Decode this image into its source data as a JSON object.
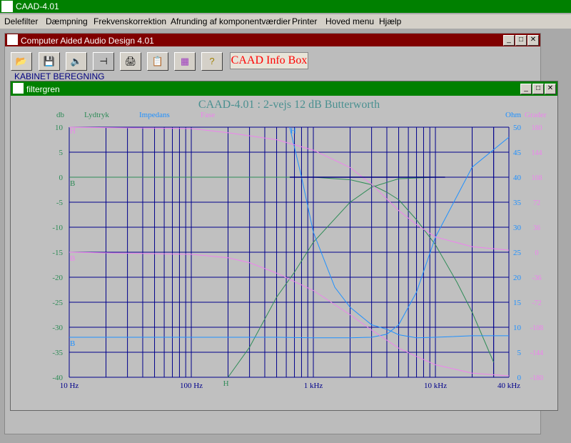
{
  "app": {
    "title": "CAAD-4.01"
  },
  "menu": [
    "Delefilter",
    "Dæmpning",
    "Frekvenskorrektion",
    "Afrunding af komponentværdier",
    "Printer",
    "Hoved menu",
    "Hjælp"
  ],
  "main_window": {
    "title": "Computer Aided Audio Design 4.01",
    "info_box": "CAAD Info Box",
    "kabinet_label": "KABINET BEREGNING",
    "toolbar": [
      "open-icon",
      "save-icon",
      "speaker-icon",
      "filter-icon",
      "printer-icon",
      "clipboard-icon",
      "grid-icon",
      "help-icon"
    ]
  },
  "filter_window": {
    "title": "filtergren"
  },
  "chart_data": {
    "type": "line",
    "title": "CAAD-4.01 : 2-vejs 12 dB Butterworth",
    "x_scale": "log",
    "xlim": [
      10,
      40000
    ],
    "x_tick_labels": [
      {
        "value": 10,
        "label": "10 Hz"
      },
      {
        "value": 100,
        "label": "100 Hz"
      },
      {
        "value": 1000,
        "label": "1 kHz"
      },
      {
        "value": 10000,
        "label": "10 kHz"
      },
      {
        "value": 40000,
        "label": "40 kHz"
      }
    ],
    "left_axis": {
      "unit_label": "db",
      "ylim": [
        -40,
        10
      ],
      "ticks": [
        10,
        5,
        0,
        -5,
        -10,
        -15,
        -20,
        -25,
        -30,
        -35,
        -40
      ]
    },
    "right_axis_ohm": {
      "unit_label": "Ohm",
      "ylim": [
        0,
        50
      ],
      "ticks": [
        50,
        45,
        40,
        35,
        30,
        25,
        20,
        15,
        10,
        5,
        0
      ]
    },
    "right_axis_grader": {
      "unit_label": "Grader",
      "ylim": [
        -180,
        180
      ],
      "ticks": [
        180,
        144,
        108,
        72,
        36,
        0,
        -36,
        -72,
        -108,
        -144,
        -180
      ]
    },
    "legend": [
      {
        "label": "Lydtryk",
        "color": "#2e8b57"
      },
      {
        "label": "Impedans",
        "color": "#1e90ff"
      },
      {
        "label": "Fase",
        "color": "#ee82ee"
      }
    ],
    "curve_markers": [
      {
        "text": "H",
        "color": "#ee82ee",
        "x": 10,
        "y_db": 9.5
      },
      {
        "text": "B",
        "color": "#2e8b57",
        "x": 10,
        "y_db": -1
      },
      {
        "text": "B",
        "color": "#ee82ee",
        "x": 10,
        "y_db": -16
      },
      {
        "text": "B",
        "color": "#1e90ff",
        "x": 10,
        "y_db": -33
      },
      {
        "text": "H",
        "color": "#1e90ff",
        "x": 640,
        "y_db": 9.5
      },
      {
        "text": "H",
        "color": "#2e8b57",
        "x": 180,
        "y_db": -41
      }
    ],
    "series": [
      {
        "name": "Lydtryk",
        "axis": "db",
        "color": "#2e8b57",
        "x": [
          10,
          100,
          1000,
          2000,
          3000,
          4000,
          5000,
          7000,
          10000,
          15000,
          20000,
          30000
        ],
        "y": [
          0,
          0,
          0,
          -0.5,
          -1.5,
          -3,
          -4.5,
          -8.5,
          -13.5,
          -21,
          -27,
          -37
        ]
      },
      {
        "name": "Lydtryk",
        "axis": "db",
        "color": "#2e8b57",
        "x": [
          200,
          300,
          500,
          700,
          1000,
          2000,
          3000,
          5000,
          10000
        ],
        "y": [
          -40,
          -34,
          -24,
          -19,
          -13,
          -5,
          -2,
          -0.3,
          0
        ]
      },
      {
        "name": "Impedans",
        "axis": "ohm",
        "color": "#1e90ff",
        "x": [
          10,
          100,
          500,
          1000,
          2000,
          3000,
          4000,
          5000,
          7000,
          10000,
          20000,
          40000
        ],
        "y": [
          8,
          8,
          8,
          7.9,
          7.9,
          8,
          8.6,
          10.5,
          17,
          28,
          42,
          48
        ]
      },
      {
        "name": "Impedans",
        "axis": "ohm",
        "color": "#1e90ff",
        "x": [
          640,
          800,
          1000,
          1500,
          2000,
          3000,
          4000,
          5000,
          7000,
          10000,
          20000,
          40000
        ],
        "y": [
          50,
          40,
          29,
          18,
          14,
          10.5,
          9.6,
          8.5,
          7.9,
          8,
          8.3,
          8.3
        ]
      },
      {
        "name": "Fase",
        "axis": "grader",
        "color": "#ee82ee",
        "x": [
          10,
          100,
          200,
          500,
          1000,
          2000,
          3000,
          5000,
          7000,
          10000,
          20000,
          40000
        ],
        "y": [
          180,
          178,
          172,
          162,
          147,
          122,
          98,
          60,
          40,
          22,
          8,
          3
        ]
      },
      {
        "name": "Fase",
        "axis": "grader",
        "color": "#ee82ee",
        "x": [
          10,
          100,
          200,
          300,
          500,
          1000,
          2000,
          3000,
          5000,
          7000,
          10000,
          20000,
          40000
        ],
        "y": [
          0,
          -3,
          -8,
          -15,
          -30,
          -55,
          -90,
          -112,
          -138,
          -150,
          -162,
          -174,
          -178
        ]
      },
      {
        "name": "Target",
        "axis": "db",
        "color": "#000080",
        "x": [
          640,
          12000
        ],
        "y": [
          0,
          0
        ]
      }
    ]
  },
  "colors": {
    "grid": "#00008b",
    "plot_bg": "#c0c0c0",
    "title": "#4a9090",
    "db_axis": "#2e8b57",
    "ohm_axis": "#1e90ff",
    "grader_axis": "#ee82ee"
  }
}
